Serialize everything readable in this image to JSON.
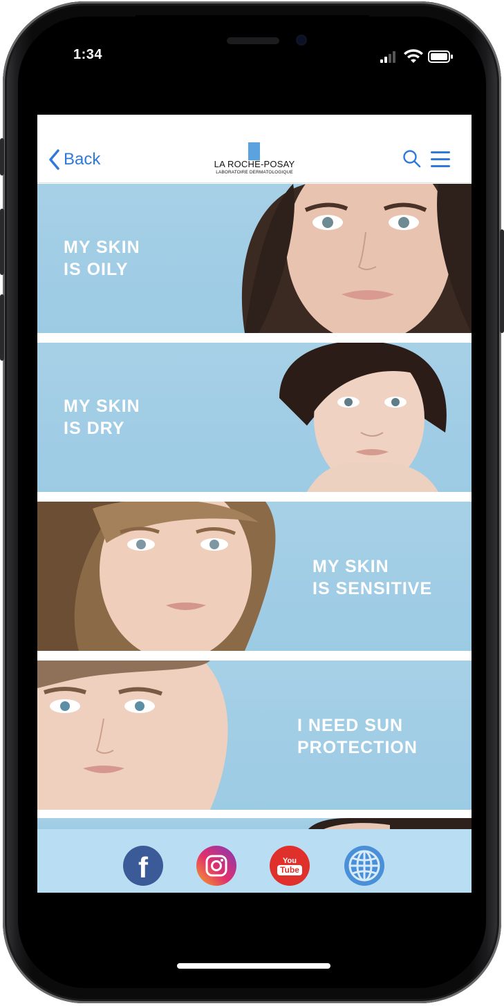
{
  "status_bar": {
    "time": "1:34"
  },
  "navbar": {
    "back_label": "Back",
    "logo_name": "LA ROCHE-POSAY",
    "logo_subtitle": "LABORATOIRE DERMATOLOGIQUE",
    "search_icon": "search-icon",
    "menu_icon": "hamburger-menu-icon"
  },
  "banners": [
    {
      "text": "MY SKIN\nIS OILY"
    },
    {
      "text": "MY SKIN\nIS DRY"
    },
    {
      "text": "MY SKIN\nIS SENSITIVE"
    },
    {
      "text": "I NEED SUN\nPROTECTION"
    }
  ],
  "social": {
    "facebook_letter": "f",
    "youtube_top": "You",
    "youtube_bottom": "Tube",
    "icons": [
      "facebook-icon",
      "instagram-icon",
      "youtube-icon",
      "globe-icon"
    ]
  },
  "colors": {
    "accent": "#2f7ad8",
    "banner_blue": "#a6d0e6",
    "social_bar": "#b9def4",
    "logo_blue": "#5ba3df"
  }
}
